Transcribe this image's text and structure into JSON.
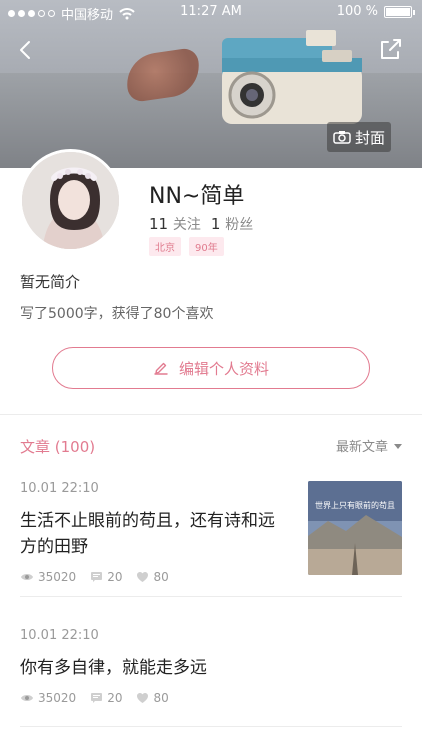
{
  "status_bar": {
    "carrier": "中国移动",
    "time": "11:27 AM",
    "battery": "100 %"
  },
  "cover": {
    "cover_button_label": "封面"
  },
  "profile": {
    "name": "NN~简单",
    "follow_count": "11",
    "follow_label": "关注",
    "fans_count": "1",
    "fans_label": "粉丝",
    "tags": [
      "北京",
      "90年"
    ],
    "bio": "暂无简介",
    "summary": "写了5000字，获得了80个喜欢",
    "edit_label": "编辑个人资料"
  },
  "articles": {
    "header": "文章 (100)",
    "sort_label": "最新文章",
    "items": [
      {
        "date": "10.01 22:10",
        "title": "生活不止眼前的苟且，还有诗和远方的田野",
        "views": "35020",
        "comments": "20",
        "likes": "80",
        "thumb_text": "世界上只有眼前的苟且"
      },
      {
        "date": "10.01 22:10",
        "title": "你有多自律，就能走多远",
        "views": "35020",
        "comments": "20",
        "likes": "80"
      }
    ]
  },
  "colors": {
    "accent": "#e27b90",
    "muted": "#9a9a9a"
  },
  "icons": [
    "back-icon",
    "share-icon",
    "camera-icon",
    "pencil-icon",
    "eye-icon",
    "comment-icon",
    "heart-icon",
    "chevron-down-icon"
  ]
}
